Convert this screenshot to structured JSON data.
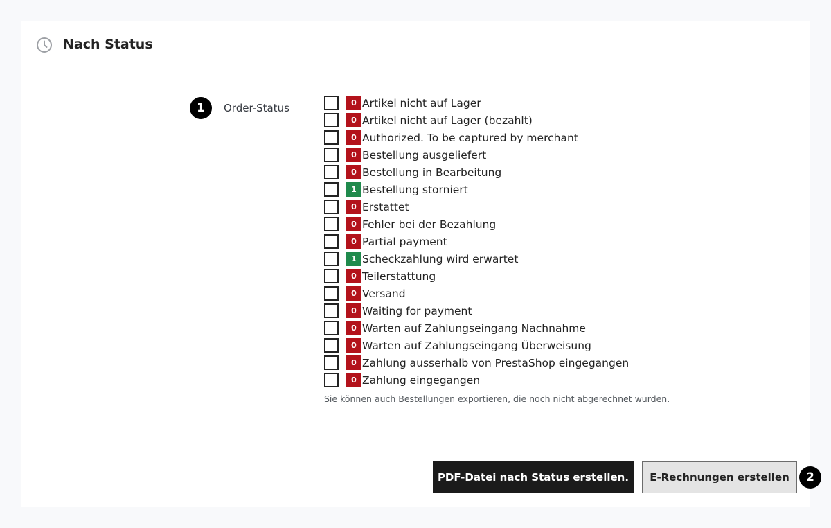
{
  "panel": {
    "title": "Nach Status",
    "icon": "clock-icon"
  },
  "form": {
    "step_one": "1",
    "field_label": "Order-Status",
    "help_text": "Sie können auch Bestellungen exportieren, die noch nicht abgerechnet wurden."
  },
  "statuses": [
    {
      "count": "0",
      "label": "Artikel nicht auf Lager"
    },
    {
      "count": "0",
      "label": "Artikel nicht auf Lager (bezahlt)"
    },
    {
      "count": "0",
      "label": "Authorized. To be captured by merchant"
    },
    {
      "count": "0",
      "label": "Bestellung ausgeliefert"
    },
    {
      "count": "0",
      "label": "Bestellung in Bearbeitung"
    },
    {
      "count": "1",
      "label": "Bestellung storniert"
    },
    {
      "count": "0",
      "label": "Erstattet"
    },
    {
      "count": "0",
      "label": "Fehler bei der Bezahlung"
    },
    {
      "count": "0",
      "label": "Partial payment"
    },
    {
      "count": "1",
      "label": "Scheckzahlung wird erwartet"
    },
    {
      "count": "0",
      "label": "Teilerstattung"
    },
    {
      "count": "0",
      "label": "Versand"
    },
    {
      "count": "0",
      "label": "Waiting for payment"
    },
    {
      "count": "0",
      "label": "Warten auf Zahlungseingang Nachnahme"
    },
    {
      "count": "0",
      "label": "Warten auf Zahlungseingang Überweisung"
    },
    {
      "count": "0",
      "label": "Zahlung ausserhalb von PrestaShop eingegangen"
    },
    {
      "count": "0",
      "label": "Zahlung eingegangen"
    }
  ],
  "colors": {
    "count_zero": "#b3121b",
    "count_nonzero": "#1f8a4c"
  },
  "footer": {
    "pdf_button": "PDF-Datei nach Status erstellen.",
    "einvoice_button": "E-Rechnungen erstellen",
    "step_two": "2"
  }
}
